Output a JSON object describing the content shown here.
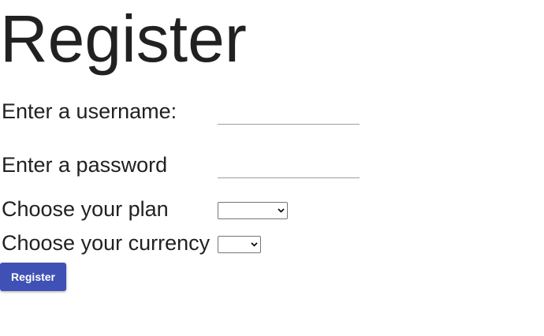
{
  "form": {
    "title": "Register",
    "username_label": "Enter a username:",
    "username_value": "",
    "password_label": "Enter a password",
    "password_value": "",
    "plan_label": "Choose your plan",
    "plan_selected": "",
    "currency_label": "Choose your currency",
    "currency_selected": "",
    "submit_label": "Register"
  },
  "colors": {
    "primary_button": "#3f51b5",
    "text": "#212121"
  },
  "icons": {
    "select_arrow": "chevron-down-icon"
  }
}
